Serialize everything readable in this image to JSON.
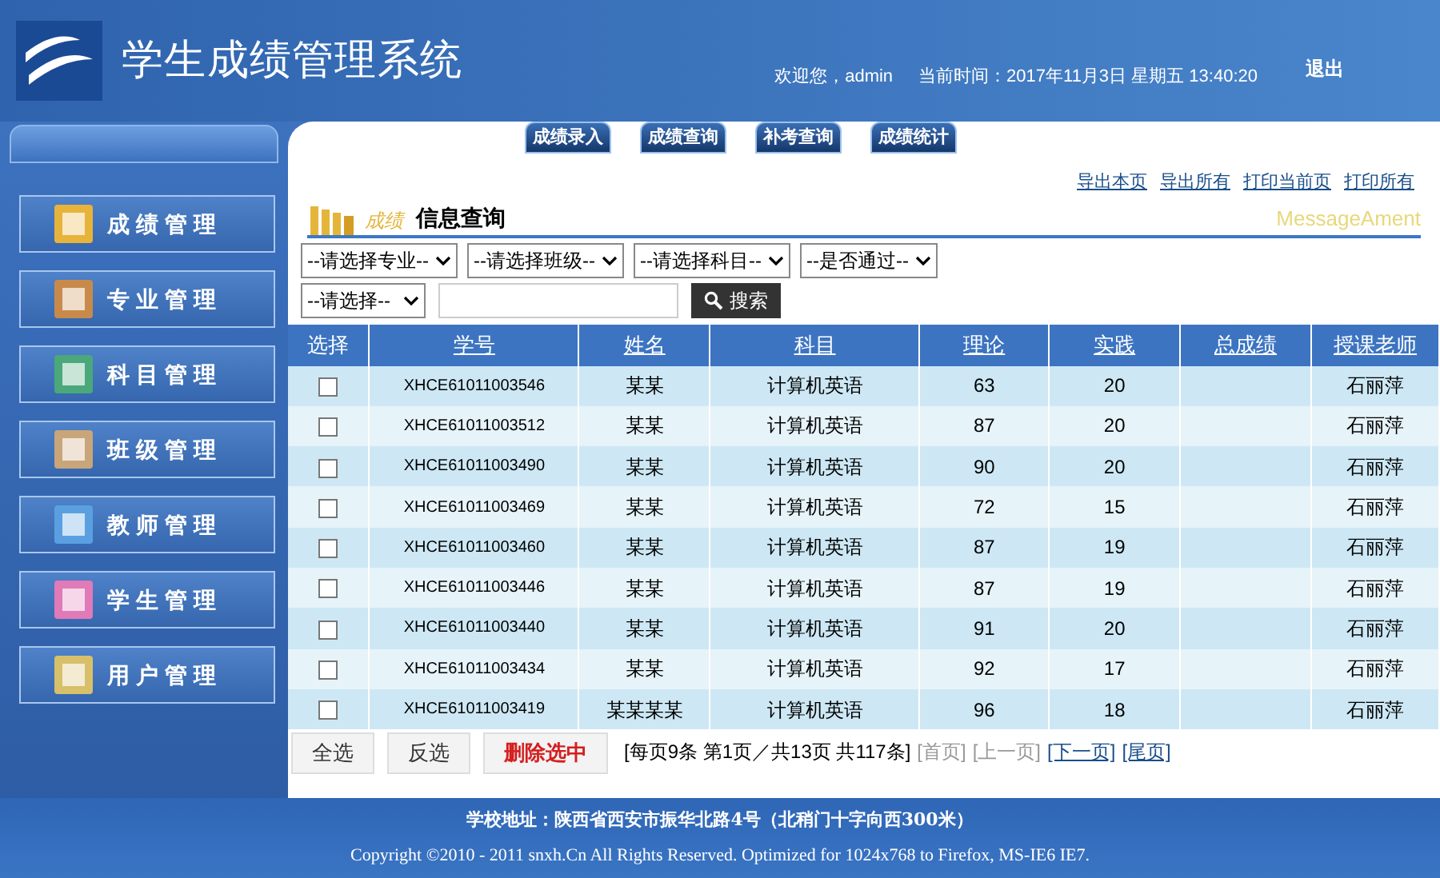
{
  "header": {
    "title": "学生成绩管理系统",
    "welcome": "欢迎您，admin",
    "time": "当前时间：2017年11月3日 星期五 13:40:20",
    "logout": "退出"
  },
  "top_tabs": [
    "成绩录入",
    "成绩查询",
    "补考查询",
    "成绩统计"
  ],
  "sidebar": {
    "items": [
      {
        "label": "成绩管理"
      },
      {
        "label": "专业管理"
      },
      {
        "label": "科目管理"
      },
      {
        "label": "班级管理"
      },
      {
        "label": "教师管理"
      },
      {
        "label": "学生管理"
      },
      {
        "label": "用户管理"
      }
    ]
  },
  "links": [
    "导出本页",
    "导出所有",
    "打印当前页",
    "打印所有"
  ],
  "section": {
    "prefix": "成绩",
    "title": "信息查询",
    "tag": "MessageAment"
  },
  "filters": [
    "--请选择专业--",
    "--请选择班级--",
    "--请选择科目--",
    "--是否通过--"
  ],
  "search": {
    "select": "--请选择--",
    "button": "搜索"
  },
  "table": {
    "columns": [
      "选择",
      "学号",
      "姓名",
      "科目",
      "理论",
      "实践",
      "总成绩",
      "授课老师"
    ],
    "rows": [
      {
        "checked": false,
        "cells": [
          "",
          "XHCE61011003546",
          "某某",
          "计算机英语",
          "63",
          "20",
          "",
          "石丽萍"
        ]
      },
      {
        "checked": false,
        "cells": [
          "",
          "XHCE61011003512",
          "某某",
          "计算机英语",
          "87",
          "20",
          "",
          "石丽萍"
        ]
      },
      {
        "checked": false,
        "cells": [
          "",
          "XHCE61011003490",
          "某某",
          "计算机英语",
          "90",
          "20",
          "",
          "石丽萍"
        ]
      },
      {
        "checked": false,
        "cells": [
          "",
          "XHCE61011003469",
          "某某",
          "计算机英语",
          "72",
          "15",
          "",
          "石丽萍"
        ]
      },
      {
        "checked": false,
        "cells": [
          "",
          "XHCE61011003460",
          "某某",
          "计算机英语",
          "87",
          "19",
          "",
          "石丽萍"
        ]
      },
      {
        "checked": false,
        "cells": [
          "",
          "XHCE61011003446",
          "某某",
          "计算机英语",
          "87",
          "19",
          "",
          "石丽萍"
        ]
      },
      {
        "checked": false,
        "cells": [
          "",
          "XHCE61011003440",
          "某某",
          "计算机英语",
          "91",
          "20",
          "",
          "石丽萍"
        ]
      },
      {
        "checked": false,
        "cells": [
          "",
          "XHCE61011003434",
          "某某",
          "计算机英语",
          "92",
          "17",
          "",
          "石丽萍"
        ]
      },
      {
        "checked": false,
        "cells": [
          "",
          "XHCE61011003419",
          "某某某某",
          "计算机英语",
          "96",
          "18",
          "",
          "石丽萍"
        ]
      }
    ]
  },
  "actions": [
    {
      "label": "全选",
      "kind": "normal"
    },
    {
      "label": "反选",
      "kind": "normal"
    },
    {
      "label": "删除选中",
      "kind": "danger"
    }
  ],
  "pager": {
    "info": "[每页9条 第1页／共13页 共117条]",
    "links": [
      {
        "label": "[首页]",
        "disabled": true
      },
      {
        "label": "[上一页]",
        "disabled": true
      },
      {
        "label": "[下一页]",
        "disabled": false
      },
      {
        "label": "[尾页]",
        "disabled": false
      }
    ]
  },
  "footer": {
    "address": "学校地址：陕西省西安市振华北路4号（北稍门十字向西300米）",
    "copyright": "Copyright ©2010 - 2011 snxh.Cn All Rights Reserved. Optimized for 1024x768 to Firefox, MS-IE6 IE7."
  }
}
